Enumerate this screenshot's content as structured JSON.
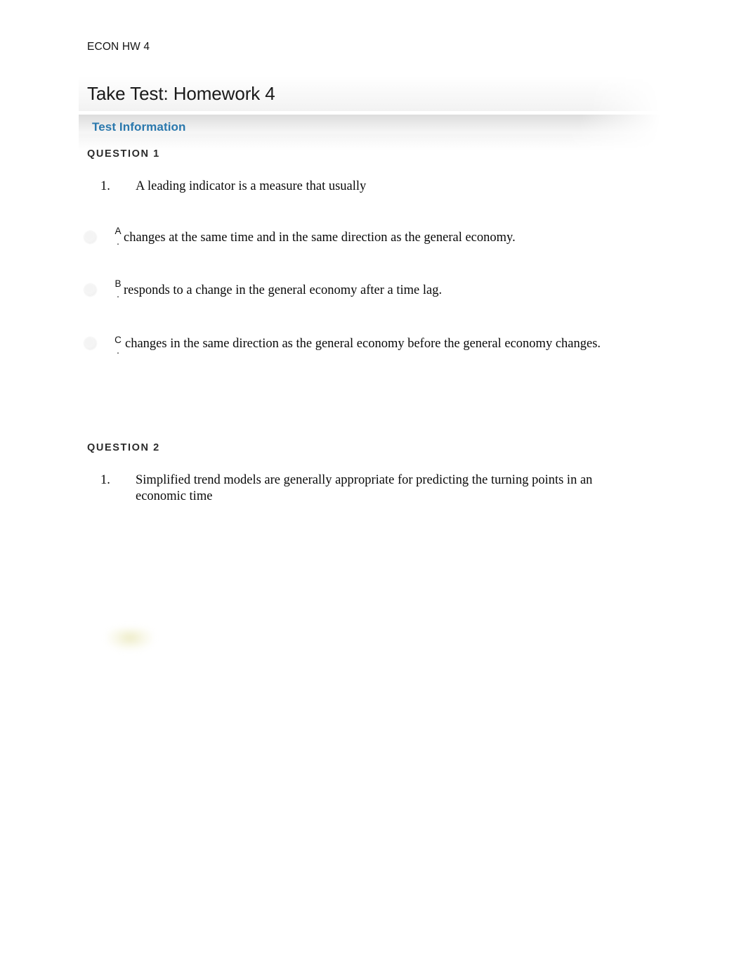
{
  "document": {
    "running_head": "ECON HW 4"
  },
  "header": {
    "title": "Take Test: Homework 4",
    "section_title": "Test Information",
    "accent_color": "#2a78ad",
    "band_color": "#dcdcdc"
  },
  "questions": [
    {
      "label": "QUESTION 1",
      "number": "1.",
      "stem": "A leading indicator is a measure that usually",
      "options": [
        {
          "letter": "A",
          "dot": ".",
          "text": "changes at the same time and in the same direction as the general economy.",
          "selected": false
        },
        {
          "letter": "B",
          "dot": ".",
          "text": "responds to a change in the general economy after a time lag.",
          "selected": false
        },
        {
          "letter": "C",
          "dot": ".",
          "text": "changes in the same direction as the general economy before the general economy changes.",
          "selected": false
        }
      ]
    },
    {
      "label": "QUESTION 2",
      "number": "1.",
      "stem": "Simplified trend models are generally appropriate for predicting the turning points in an economic time",
      "options": []
    }
  ]
}
